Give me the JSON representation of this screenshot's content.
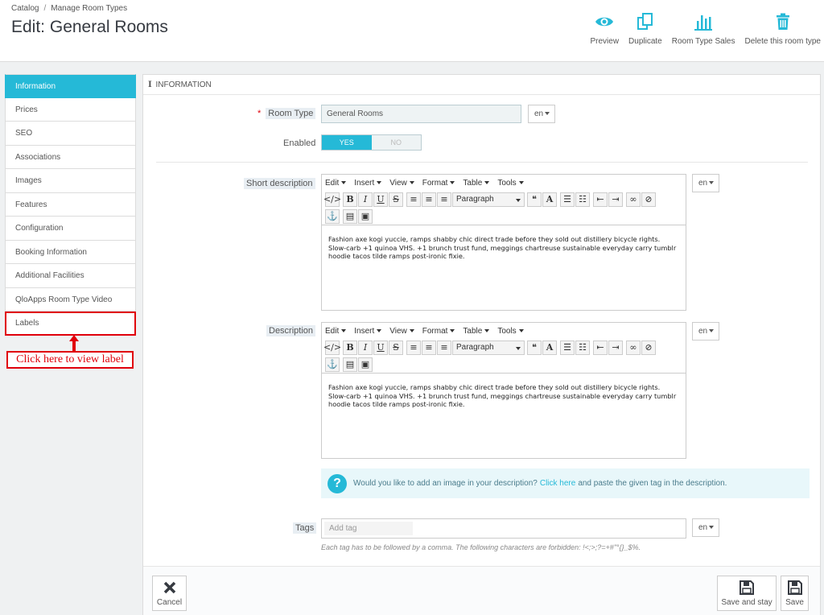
{
  "breadcrumb": [
    "Catalog",
    "Manage Room Types"
  ],
  "breadcrumb_sep": "/",
  "page_title": "Edit: General Rooms",
  "toolbar": {
    "preview": "Preview",
    "duplicate": "Duplicate",
    "sales": "Room Type Sales",
    "delete": "Delete this room type"
  },
  "sidebar": {
    "items": [
      {
        "label": "Information"
      },
      {
        "label": "Prices"
      },
      {
        "label": "SEO"
      },
      {
        "label": "Associations"
      },
      {
        "label": "Images"
      },
      {
        "label": "Features"
      },
      {
        "label": "Configuration"
      },
      {
        "label": "Booking Information"
      },
      {
        "label": "Additional Facilities"
      },
      {
        "label": "QloApps Room Type Video"
      },
      {
        "label": "Labels"
      }
    ]
  },
  "callout": "Click here to view label",
  "panel": {
    "heading": "INFORMATION",
    "heading_icon": "i"
  },
  "form": {
    "room_type_label": "Room Type",
    "room_type_value": "General Rooms",
    "required_mark": "*",
    "lang": "en",
    "enabled_label": "Enabled",
    "yes": "YES",
    "no": "NO",
    "enabled_value": "YES",
    "short_desc_label": "Short description",
    "description_label": "Description",
    "tags_label": "Tags",
    "tags_placeholder": "Add tag",
    "tags_help": "Each tag has to be followed by a comma. The following characters are forbidden: !<;>;?=+#\"°{}_$%."
  },
  "editor": {
    "menus": [
      "Edit",
      "Insert",
      "View",
      "Format",
      "Table",
      "Tools"
    ],
    "format_select": "Paragraph",
    "short_text": "Fashion axe kogi yuccie, ramps shabby chic direct trade before they sold out distillery bicycle rights. Slow-carb +1 quinoa VHS. +1 brunch trust fund, meggings chartreuse sustainable everyday carry tumblr hoodie tacos tilde ramps post-ironic fixie.",
    "desc_text": "Fashion axe kogi yuccie, ramps shabby chic direct trade before they sold out distillery bicycle rights. Slow-carb +1 quinoa VHS. +1 brunch trust fund, meggings chartreuse sustainable everyday carry tumblr hoodie tacos tilde ramps post-ironic fixie."
  },
  "info": {
    "text_before": "Would you like to add an image in your description?",
    "link": "Click here",
    "text_after": "and paste the given tag in the description."
  },
  "footer": {
    "cancel": "Cancel",
    "save_stay": "Save and stay",
    "save": "Save"
  },
  "colors": {
    "accent": "#25b9d7",
    "callout_red": "#e0000b"
  }
}
